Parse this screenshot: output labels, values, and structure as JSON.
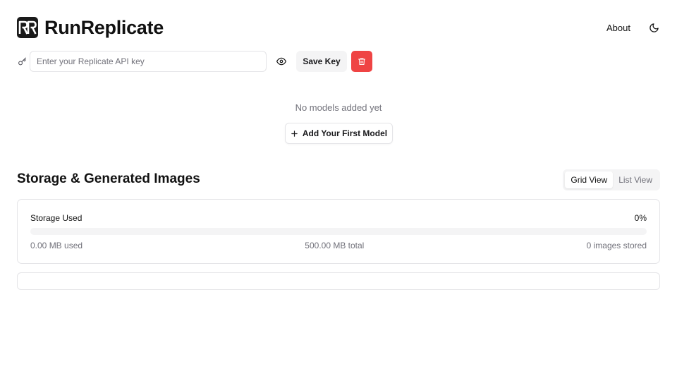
{
  "app": {
    "title": "RunReplicate",
    "logo_icon": "runreplicate-logo"
  },
  "header": {
    "about_label": "About",
    "theme_icon": "moon-icon"
  },
  "api_key": {
    "placeholder": "Enter your Replicate API key",
    "value": "",
    "key_icon": "key-icon",
    "visibility_icon": "eye-icon",
    "save_label": "Save Key",
    "delete_icon": "trash-icon"
  },
  "models": {
    "empty_message": "No models added yet",
    "add_first_label": "Add Your First Model",
    "add_icon": "plus-icon"
  },
  "storage": {
    "section_title": "Storage & Generated Images",
    "view_tabs": [
      {
        "label": "Grid View",
        "active": true
      },
      {
        "label": "List View",
        "active": false
      }
    ],
    "used_label": "Storage Used",
    "percent_label": "0%",
    "percent_value": 0,
    "used_text": "0.00 MB used",
    "total_text": "500.00 MB total",
    "images_text": "0 images stored"
  },
  "colors": {
    "primary": "#18181b",
    "danger": "#ef4444",
    "muted_text": "#71717a",
    "border": "#e4e4e7",
    "muted_bg": "#f4f4f5"
  }
}
